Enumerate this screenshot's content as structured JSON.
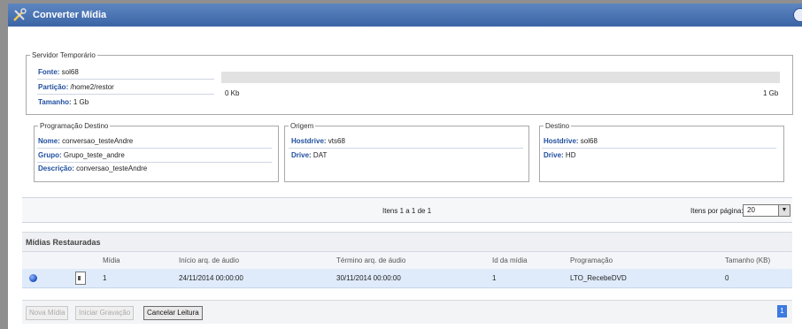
{
  "window": {
    "title": "Converter Mídia"
  },
  "servidor": {
    "legend": "Servidor Temporário",
    "fonte_label": "Fonte:",
    "fonte_value": "sol68",
    "particao_label": "Partição:",
    "particao_value": "/home2/restor",
    "tamanho_label": "Tamanho:",
    "tamanho_value": "1 Gb",
    "usage_pct_text": "0%",
    "usage_fraction": 0,
    "min_label": "0 Kb",
    "max_label": "1 Gb"
  },
  "programacao": {
    "legend": "Programação Destino",
    "nome_label": "Nome:",
    "nome_value": "conversao_testeAndre",
    "grupo_label": "Grupo:",
    "grupo_value": "Grupo_teste_andre",
    "descricao_label": "Descrição:",
    "descricao_value": "conversao_testeAndre"
  },
  "origem": {
    "legend": "Origem",
    "hostdrive_label": "Hostdrive:",
    "hostdrive_value": "vts68",
    "drive_label": "Drive:",
    "drive_value": "DAT"
  },
  "destino": {
    "legend": "Destino",
    "hostdrive_label": "Hostdrive:",
    "hostdrive_value": "sol68",
    "drive_label": "Drive:",
    "drive_value": "HD"
  },
  "pager": {
    "items_text": "Itens 1 a 1 de 1",
    "per_page_label": "Itens por página:",
    "per_page_value": "20"
  },
  "table": {
    "title": "Mídias Restauradas",
    "columns": [
      "Mídia",
      "Início arq. de áudio",
      "Término arq. de áudio",
      "Id da mídia",
      "Programação",
      "Tamanho (KB)"
    ],
    "rows": [
      {
        "midia": "1",
        "inicio": "24/11/2014 00:00:00",
        "termino": "30/11/2014 00:00:00",
        "id": "1",
        "programacao": "LTO_RecebeDVD",
        "tamanho": "0"
      }
    ]
  },
  "footer": {
    "nova_midia": "Nova Mídia",
    "iniciar_gravacao": "Iniciar Gravação",
    "cancelar_leitura": "Cancelar Leitura",
    "page_number": "1"
  },
  "colors": {
    "titlebar": "#3b64a5",
    "label": "#1f4e9e",
    "row_selected": "#dfebfb"
  }
}
